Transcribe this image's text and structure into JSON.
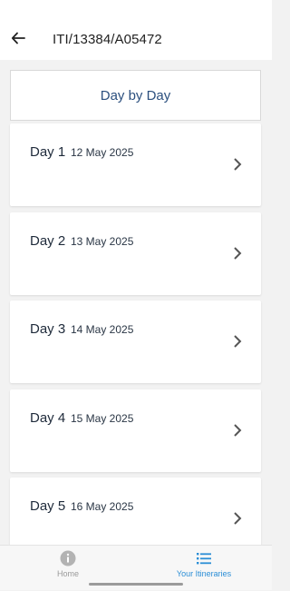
{
  "appbar": {
    "title": "ITI/13384/A05472"
  },
  "section": {
    "title": "Day by Day"
  },
  "days": [
    {
      "label": "Day 1",
      "date": "12 May 2025"
    },
    {
      "label": "Day 2",
      "date": "13 May 2025"
    },
    {
      "label": "Day 3",
      "date": "14 May 2025"
    },
    {
      "label": "Day 4",
      "date": "15 May 2025"
    },
    {
      "label": "Day 5",
      "date": "16 May 2025"
    }
  ],
  "nav": {
    "home": {
      "label": "Home",
      "icon": "info-icon"
    },
    "itineraries": {
      "label": "Your Itineraries",
      "icon": "list-icon",
      "active": true
    }
  },
  "colors": {
    "accent": "#2b8ed6",
    "header_text": "#2b4f7e"
  }
}
